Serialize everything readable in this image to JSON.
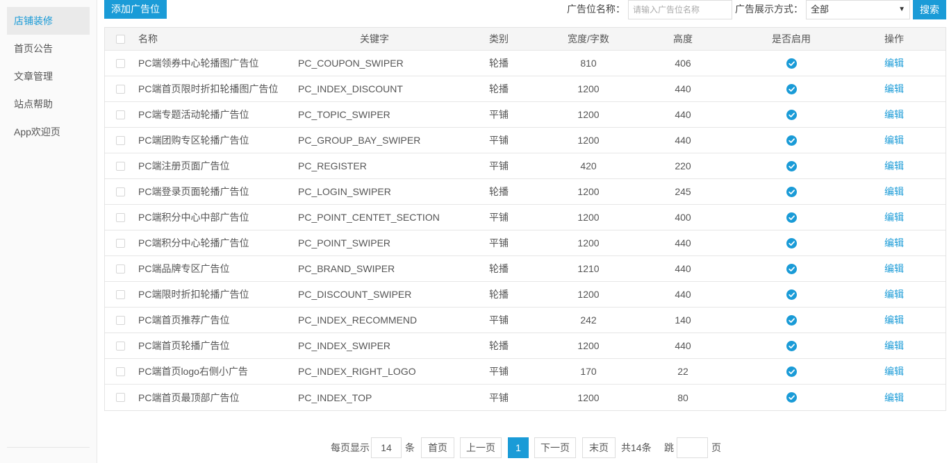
{
  "sidebar": {
    "items": [
      {
        "label": "店铺装修",
        "active": true
      },
      {
        "label": "首页公告",
        "active": false
      },
      {
        "label": "文章管理",
        "active": false
      },
      {
        "label": "站点帮助",
        "active": false
      },
      {
        "label": "App欢迎页",
        "active": false
      }
    ]
  },
  "toolbar": {
    "add_label": "添加广告位",
    "name_label": "广告位名称：",
    "name_placeholder": "请输入广告位名称",
    "name_value": "",
    "mode_label": "广告展示方式：",
    "mode_value": "全部",
    "search_label": "搜索"
  },
  "table": {
    "headers": {
      "name": "名称",
      "key": "关键字",
      "type": "类别",
      "width": "宽度/字数",
      "height": "高度",
      "enabled": "是否启用",
      "op": "操作"
    },
    "edit_label": "编辑",
    "rows": [
      {
        "name": "PC端领券中心轮播图广告位",
        "key": "PC_COUPON_SWIPER",
        "type": "轮播",
        "width": "810",
        "height": "406",
        "enabled": true
      },
      {
        "name": "PC端首页限时折扣轮播图广告位",
        "key": "PC_INDEX_DISCOUNT",
        "type": "轮播",
        "width": "1200",
        "height": "440",
        "enabled": true
      },
      {
        "name": "PC端专题活动轮播广告位",
        "key": "PC_TOPIC_SWIPER",
        "type": "平铺",
        "width": "1200",
        "height": "440",
        "enabled": true
      },
      {
        "name": "PC端团购专区轮播广告位",
        "key": "PC_GROUP_BAY_SWIPER",
        "type": "平铺",
        "width": "1200",
        "height": "440",
        "enabled": true
      },
      {
        "name": "PC端注册页面广告位",
        "key": "PC_REGISTER",
        "type": "平铺",
        "width": "420",
        "height": "220",
        "enabled": true
      },
      {
        "name": "PC端登录页面轮播广告位",
        "key": "PC_LOGIN_SWIPER",
        "type": "轮播",
        "width": "1200",
        "height": "245",
        "enabled": true
      },
      {
        "name": "PC端积分中心中部广告位",
        "key": "PC_POINT_CENTET_SECTION",
        "type": "平铺",
        "width": "1200",
        "height": "400",
        "enabled": true
      },
      {
        "name": "PC端积分中心轮播广告位",
        "key": "PC_POINT_SWIPER",
        "type": "平铺",
        "width": "1200",
        "height": "440",
        "enabled": true
      },
      {
        "name": "PC端品牌专区广告位",
        "key": "PC_BRAND_SWIPER",
        "type": "轮播",
        "width": "1210",
        "height": "440",
        "enabled": true
      },
      {
        "name": "PC端限时折扣轮播广告位",
        "key": "PC_DISCOUNT_SWIPER",
        "type": "轮播",
        "width": "1200",
        "height": "440",
        "enabled": true
      },
      {
        "name": "PC端首页推荐广告位",
        "key": "PC_INDEX_RECOMMEND",
        "type": "平铺",
        "width": "242",
        "height": "140",
        "enabled": true
      },
      {
        "name": "PC端首页轮播广告位",
        "key": "PC_INDEX_SWIPER",
        "type": "轮播",
        "width": "1200",
        "height": "440",
        "enabled": true
      },
      {
        "name": "PC端首页logo右侧小广告",
        "key": "PC_INDEX_RIGHT_LOGO",
        "type": "平铺",
        "width": "170",
        "height": "22",
        "enabled": true
      },
      {
        "name": "PC端首页最顶部广告位",
        "key": "PC_INDEX_TOP",
        "type": "平铺",
        "width": "1200",
        "height": "80",
        "enabled": true
      }
    ]
  },
  "pager": {
    "per_page_label": "每页显示",
    "per_page_value": "14",
    "per_page_unit": "条",
    "first": "首页",
    "prev": "上一页",
    "current": "1",
    "next": "下一页",
    "last": "末页",
    "total": "共14条",
    "jump_label": "跳",
    "jump_value": "",
    "jump_unit": "页"
  },
  "colors": {
    "accent": "#1a9bd7"
  }
}
